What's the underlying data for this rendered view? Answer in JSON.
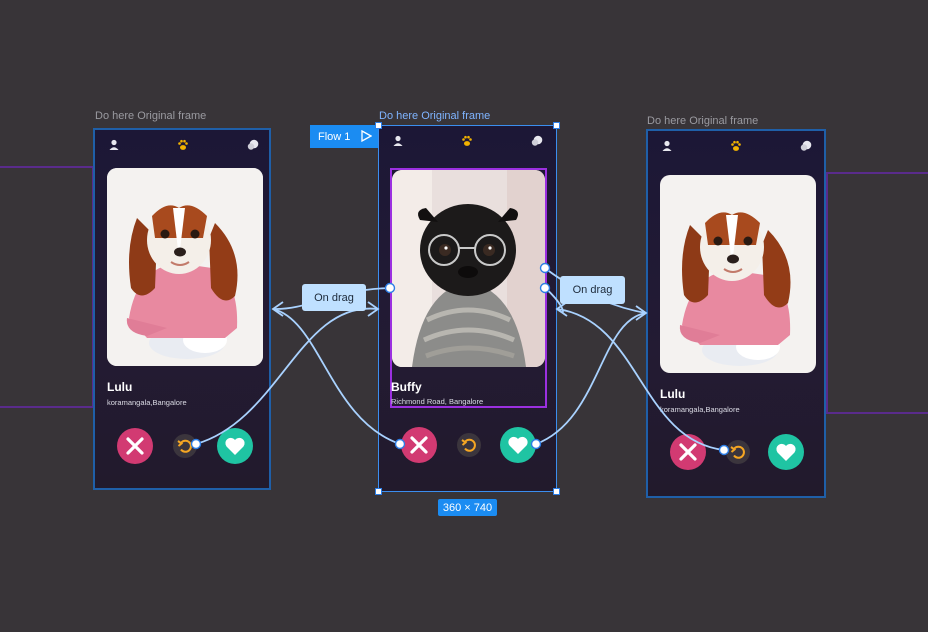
{
  "canvas": {
    "background": "#383438",
    "frames": [
      {
        "label": "Do here Original frame",
        "dog_name": "Lulu",
        "location": "koramangala,Bangalore"
      },
      {
        "label": "Do here Original frame",
        "dog_name": "Buffy",
        "location": "Richmond Road, Bangalore"
      },
      {
        "label": "Do here Original frame",
        "dog_name": "Lulu",
        "location": "koramangala,Bangalore"
      }
    ],
    "flow_tag": "Flow 1",
    "size_badge": "360 × 740",
    "interactions": [
      "On drag",
      "On drag"
    ]
  },
  "icons": {
    "profile": "user-icon",
    "paw": "paw-icon",
    "chat": "chat-icon",
    "dislike": "close-icon",
    "undo": "undo-icon",
    "like": "heart-icon",
    "play": "play-icon"
  },
  "colors": {
    "selection": "#1b8cf2",
    "wire": "#a9d2ff",
    "paw": "#f2b300",
    "dislike": "#d23a72",
    "like": "#1fc4a3",
    "undo_ring": "#f5a623",
    "frame_border": "#5a2b8c"
  }
}
